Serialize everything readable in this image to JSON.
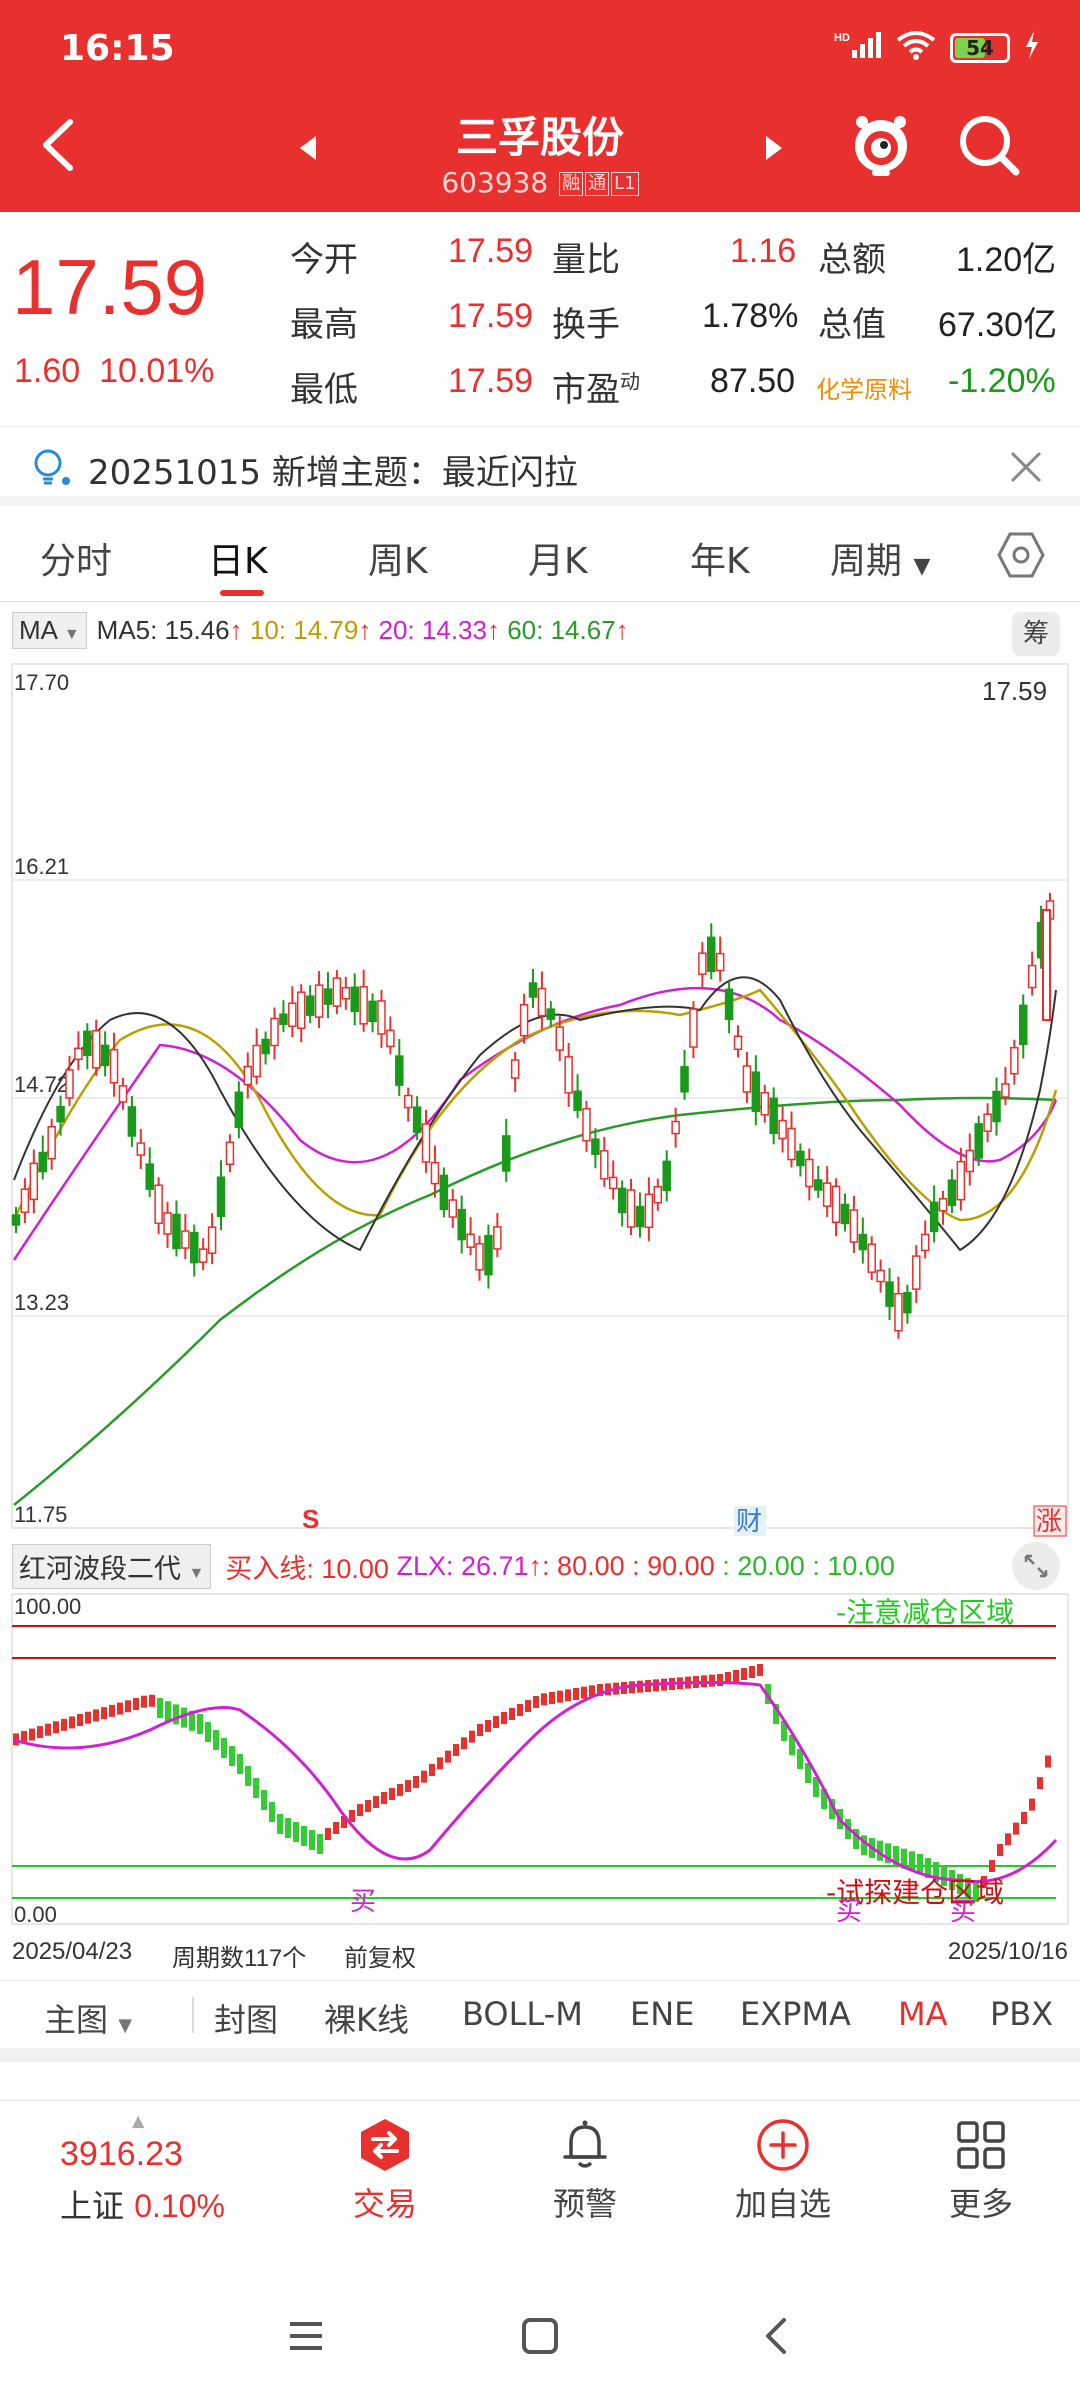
{
  "status": {
    "time": "16:15",
    "battery": "54",
    "signal_label": "HD"
  },
  "header": {
    "stock_name": "三孚股份",
    "stock_code": "603938",
    "tags": [
      "融",
      "通",
      "L1"
    ],
    "colors": {
      "bg": "#e8312f"
    }
  },
  "quote": {
    "price": "17.59",
    "change": "1.60",
    "change_pct": "10.01%",
    "rows": [
      {
        "l1": "今开",
        "v1": "17.59",
        "l2": "量比",
        "v2": "1.16",
        "l3": "总额",
        "v3": "1.20亿"
      },
      {
        "l1": "最高",
        "v1": "17.59",
        "l2": "换手",
        "v2": "1.78%",
        "l3": "总值",
        "v3": "67.30亿"
      },
      {
        "l1": "最低",
        "v1": "17.59",
        "l2": "市盈",
        "l2sup": "动",
        "v2": "87.50",
        "l3": "化学原料",
        "v3": "-1.20%"
      }
    ]
  },
  "notice": {
    "text": "20251015 新增主题：最近闪拉"
  },
  "tabs": [
    "分时",
    "日K",
    "周K",
    "月K",
    "年K",
    "周期"
  ],
  "ma_legend": {
    "select": "MA",
    "items": [
      {
        "text": "MA5: 15.46",
        "color": "#333333"
      },
      {
        "text": "10: 14.79",
        "color": "#b8a000"
      },
      {
        "text": "20: 14.33",
        "color": "#d020d0"
      },
      {
        "text": "60: 14.67",
        "color": "#2a9a2a"
      }
    ],
    "fu": "筹"
  },
  "chart_data": [
    {
      "type": "candlestick",
      "title": "",
      "y_ticks": [
        "17.70",
        "16.21",
        "14.72",
        "13.23",
        "11.75"
      ],
      "ylim": [
        11.75,
        17.7
      ],
      "last_price_label": "17.59",
      "markers": [
        {
          "text": "S",
          "color": "#e8312f"
        },
        {
          "text": "财",
          "color": "#3a7bd5"
        },
        {
          "text": "涨",
          "color": "#e8312f"
        }
      ],
      "x_start": "2025/04/23",
      "x_end": "2025/10/16",
      "period_count": "周期数117个",
      "adjust": "前复权",
      "series": [
        {
          "name": "MA5",
          "color": "#333333"
        },
        {
          "name": "MA10",
          "color": "#b8a000"
        },
        {
          "name": "MA20",
          "color": "#d020d0"
        },
        {
          "name": "MA60",
          "color": "#2a9a2a"
        }
      ]
    },
    {
      "type": "line",
      "title": "红河波段二代",
      "ylim": [
        0,
        100
      ],
      "y_ticks": [
        "100.00",
        "0.00"
      ],
      "levels": [
        80,
        90,
        20,
        10
      ],
      "annotations": [
        "-注意减仓区域",
        "-试探建仓区域",
        "买",
        "买",
        "买"
      ]
    }
  ],
  "indicator_legend": {
    "select": "红河波段二代",
    "items": [
      {
        "text": "买入线: 10.00",
        "color": "#e8312f"
      },
      {
        "text": "ZLX: 26.71",
        "color": "#d020d0"
      },
      {
        "text": ": 80.00",
        "color": "#e8312f"
      },
      {
        "text": ": 90.00",
        "color": "#e8312f"
      },
      {
        "text": ": 20.00",
        "color": "#2ab82a"
      },
      {
        "text": ": 10.00",
        "color": "#2ab82a"
      }
    ]
  },
  "indicator_tabs": [
    "主图",
    "封图",
    "裸K线",
    "BOLL-M",
    "ENE",
    "EXPMA",
    "MA",
    "PBX"
  ],
  "bottom_nav": {
    "index_value": "3916.23",
    "index_name": "上证",
    "index_pct": "0.10%",
    "items": [
      "交易",
      "预警",
      "加自选",
      "更多"
    ]
  }
}
